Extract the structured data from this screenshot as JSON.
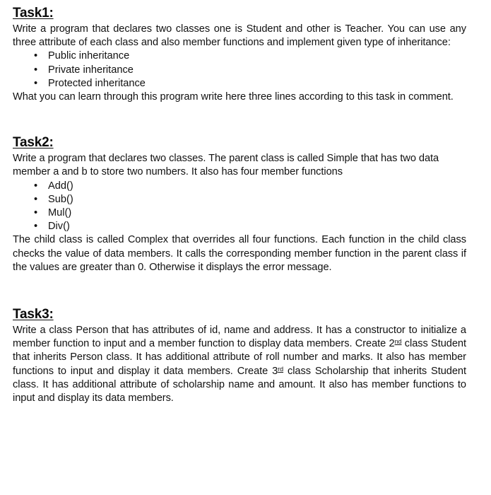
{
  "document": {
    "background_color": "#ffffff",
    "text_color": "#111111",
    "bullet_glyph": "•"
  },
  "tasks": [
    {
      "heading": "Task1:",
      "intro": "Write a program that declares two classes one is Student and other is Teacher. You can use any three attribute of each class and also member functions and implement given type of inheritance:",
      "bullets": [
        "Public inheritance",
        "Private inheritance",
        "Protected inheritance"
      ],
      "outro": "What you can learn through this program write here three lines according to this task in comment."
    },
    {
      "heading": "Task2:",
      "intro": "Write a program that declares two classes. The parent class is called Simple that has two data member a and b to store two numbers. It also has four member functions",
      "bullets": [
        "Add()",
        "Sub()",
        "Mul()",
        "Div()"
      ],
      "outro": "The child class is called Complex that overrides all four functions. Each function in the child class checks the value of data members. It calls the corresponding member function in the parent class if the values are greater than 0. Otherwise it displays the error message."
    },
    {
      "heading": "Task3:",
      "paragraph_part1": "Write a class Person that has attributes of id, name and address. It has a constructor to initialize a member function to input and a member function to display data members. Create 2",
      "ordinal_1": "nd",
      "paragraph_part2": " class Student that inherits Person class. It has additional attribute of roll number and marks. It also has member functions to input and display it data members. Create 3",
      "ordinal_2": "rd",
      "paragraph_part3": " class Scholarship that inherits Student class. It has additional attribute of scholarship name and amount. It also has member functions to input and display its data members."
    }
  ]
}
